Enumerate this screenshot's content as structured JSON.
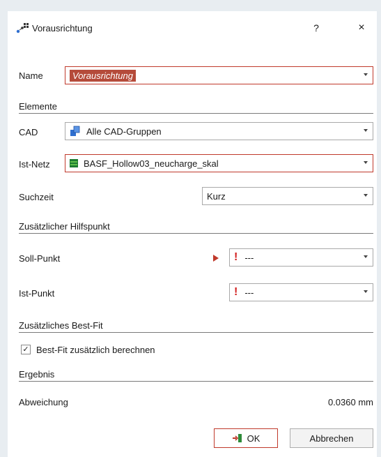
{
  "window": {
    "title": "Vorausrichtung",
    "help": "?",
    "close": "×"
  },
  "form": {
    "name_label": "Name",
    "name_value": "Vorausrichtung",
    "elements_section": "Elemente",
    "cad_label": "CAD",
    "cad_value": "Alle CAD-Gruppen",
    "mesh_label": "Ist-Netz",
    "mesh_value": "BASF_Hollow03_neucharge_skal",
    "search_label": "Suchzeit",
    "search_value": "Kurz",
    "aux_section": "Zusätzlicher Hilfspunkt",
    "target_label": "Soll-Punkt",
    "target_value": "---",
    "actual_label": "Ist-Punkt",
    "actual_value": "---",
    "bestfit_section": "Zusätzliches Best-Fit",
    "bestfit_checkbox_label": "Best-Fit zusätzlich berechnen",
    "bestfit_checked": "✓",
    "result_section": "Ergebnis",
    "deviation_label": "Abweichung",
    "deviation_value": "0.0360 mm"
  },
  "buttons": {
    "ok": "OK",
    "cancel": "Abbrechen"
  },
  "colors": {
    "accent_red": "#c0392b",
    "name_highlight": "#b54b3a",
    "warning_red": "#d21f1f",
    "mesh_green": "#1e7d32",
    "cad_blue": "#2f6fd0"
  },
  "icons": {
    "title": "alignment-points-icon",
    "cad": "cad-groups-icon",
    "mesh": "mesh-icon",
    "warning": "exclamation-icon",
    "indicator": "play-arrow-icon",
    "ok": "apply-icon"
  }
}
